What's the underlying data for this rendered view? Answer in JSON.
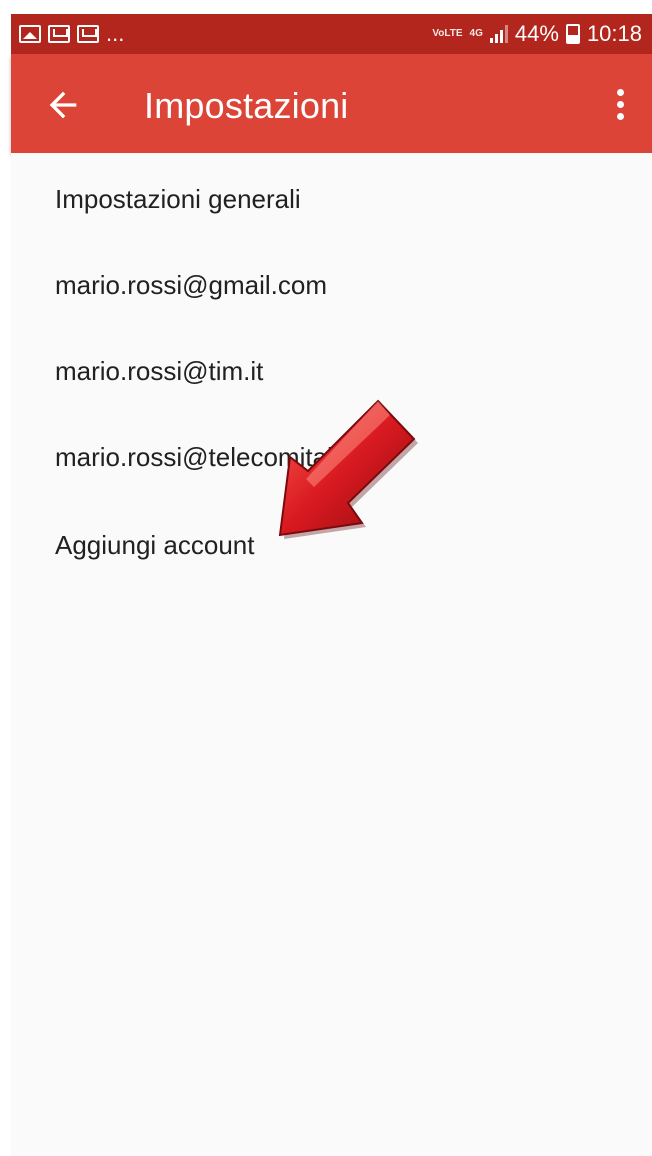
{
  "status_bar": {
    "notification_icons": [
      "gallery-icon",
      "gmail-icon",
      "gmail-icon"
    ],
    "more_notifications": "...",
    "volte_label": "VoLTE",
    "network_label": "4G",
    "battery_percent": "44%",
    "time": "10:18"
  },
  "app_bar": {
    "title": "Impostazioni",
    "back_icon": "arrow-back-icon",
    "overflow_icon": "more-vert-icon"
  },
  "settings_list": {
    "items": [
      {
        "label": "Impostazioni generali"
      },
      {
        "label": "mario.rossi@gmail.com"
      },
      {
        "label": "mario.rossi@tim.it"
      },
      {
        "label": "mario.rossi@telecomitalia.it"
      },
      {
        "label": "Aggiungi account"
      }
    ]
  },
  "overlay": {
    "annotation_icon": "red-arrow-icon",
    "color": "#d71920"
  },
  "colors": {
    "status_bar": "#b3261e",
    "app_bar": "#db4437",
    "background": "#fafafa",
    "text": "#212121"
  }
}
